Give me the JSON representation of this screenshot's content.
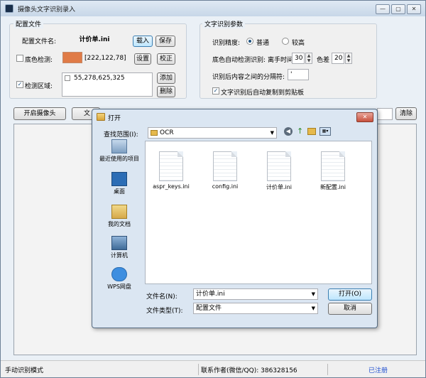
{
  "window": {
    "title": "摄像头文字识别录入",
    "controls": [
      "—",
      "▢",
      "✕"
    ]
  },
  "config": {
    "group_title": "配置文件",
    "file_label": "配置文件名:",
    "file_name": "计价单.ini",
    "load_button": "载入",
    "save_button": "保存",
    "bg_detect_label": "底色检测:",
    "bg_color": "#e07b47",
    "bg_rgb": "[222,122,78]",
    "set_button": "设置",
    "calibrate_button": "校正",
    "area_label": "检测区域:",
    "area_item": "55,278,625,325",
    "add_button": "添加",
    "delete_button": "删除"
  },
  "ocr": {
    "group_title": "文字识别参数",
    "precision_label": "识别精度:",
    "precision_normal": "普通",
    "precision_high": "较高",
    "bg_auto_label": "底色自动检测识别:",
    "tolerance_label": "离手时间",
    "tolerance_value": "30",
    "diff_label": "色差",
    "diff_value": "20",
    "separator_label": "识别后内容之间的分隔符:",
    "separator_value": "'",
    "auto_copy_label": "文字识别后自动复制到剪贴板"
  },
  "toolbar": {
    "start_camera": "开启摄像头",
    "text_button": "文",
    "clear_button": "清除"
  },
  "status": {
    "mode": "手动识别模式",
    "contact": "联系作者(微信/QQ): 386328156",
    "registered": "已注册"
  },
  "dialog": {
    "title": "打开",
    "lookin_label": "查找范围(I):",
    "lookin_value": "OCR",
    "places": [
      "最近使用的项目",
      "桌面",
      "我的文档",
      "计算机",
      "WPS网盘"
    ],
    "files": [
      "aspr_keys.ini",
      "config.ini",
      "计价单.ini",
      "新配置.ini"
    ],
    "filename_label": "文件名(N):",
    "filename_value": "计价单.ini",
    "filetype_label": "文件类型(T):",
    "filetype_value": "配置文件",
    "open_button": "打开(O)",
    "cancel_button": "取消",
    "close_icon": "✕"
  },
  "colors": {
    "accent": "#1c5180",
    "link": "#1f4fd0"
  }
}
